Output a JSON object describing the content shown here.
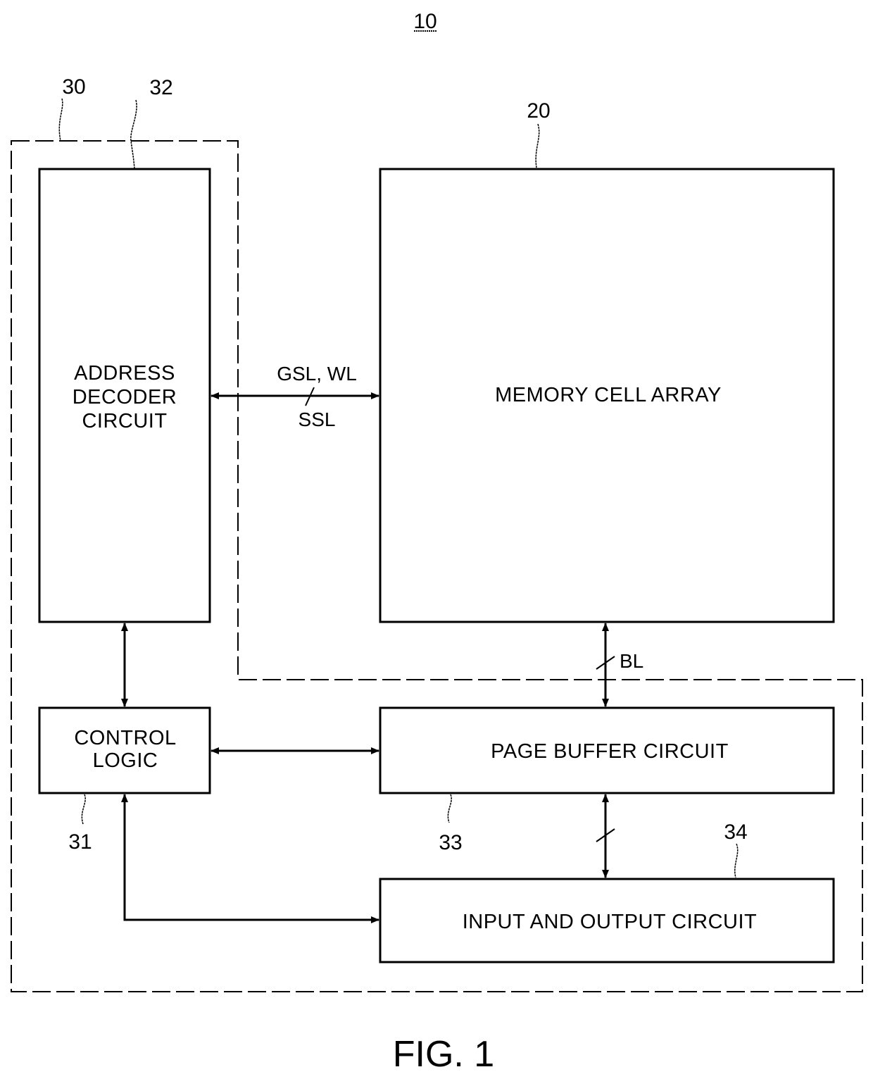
{
  "figure": {
    "ref": "10",
    "caption": "FIG. 1"
  },
  "blocks": {
    "memory_cell_array": {
      "ref": "20",
      "label_lines": [
        "MEMORY CELL ARRAY"
      ]
    },
    "peripheral_region": {
      "ref": "30"
    },
    "control_logic": {
      "ref": "31",
      "label_lines": [
        "CONTROL",
        "LOGIC"
      ]
    },
    "address_decoder": {
      "ref": "32",
      "label_lines": [
        "ADDRESS",
        "DECODER",
        "CIRCUIT"
      ]
    },
    "page_buffer": {
      "ref": "33",
      "label_lines": [
        "PAGE BUFFER CIRCUIT"
      ]
    },
    "io_circuit": {
      "ref": "34",
      "label_lines": [
        "INPUT AND OUTPUT CIRCUIT"
      ]
    }
  },
  "signals": {
    "row_lines_top": "GSL, WL",
    "row_lines_bottom": "SSL",
    "bit_lines": "BL"
  }
}
